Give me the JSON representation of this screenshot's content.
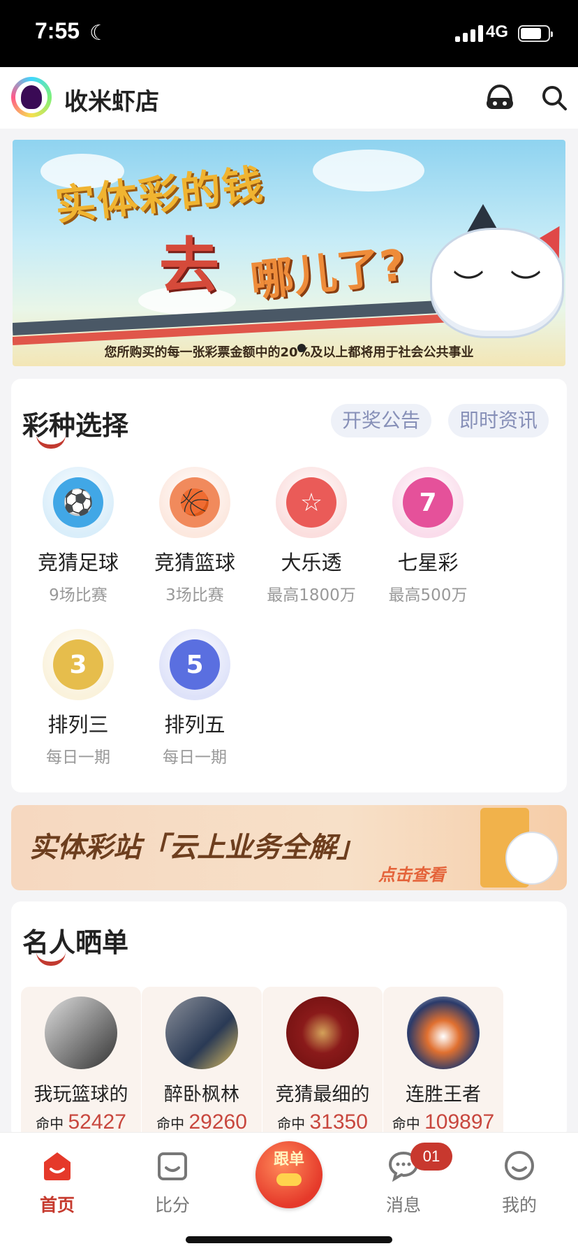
{
  "status_bar": {
    "time": "7:55",
    "network": "4G",
    "battery_level": 0.75
  },
  "header": {
    "title": "收米虾店",
    "icons": [
      "logo-icon",
      "customer-service-icon",
      "search-icon"
    ]
  },
  "banner": {
    "line1": "实体彩的钱",
    "line2": "去",
    "line3": "哪儿了?",
    "caption": "您所购买的每一张彩票金额中的20%及以上都将用于社会公共事业",
    "page_index": 1
  },
  "lottery": {
    "title": "彩种选择",
    "links": [
      "开奖公告",
      "即时资讯"
    ],
    "items": [
      {
        "name": "竞猜足球",
        "sub": "9场比赛",
        "icon": "soccer-ball-icon",
        "glyph": "⚽",
        "color": "#41a7e6"
      },
      {
        "name": "竞猜篮球",
        "sub": "3场比赛",
        "icon": "basketball-icon",
        "glyph": "🏀",
        "color": "#f18a5c"
      },
      {
        "name": "大乐透",
        "sub": "最高1800万",
        "icon": "star-ball-icon",
        "glyph": "☆",
        "color": "#ea5b58"
      },
      {
        "name": "七星彩",
        "sub": "最高500万",
        "icon": "seven-star-icon",
        "glyph": "7",
        "color": "#e5519a"
      },
      {
        "name": "排列三",
        "sub": "每日一期",
        "icon": "number-three-icon",
        "glyph": "3",
        "color": "#e6bd4c"
      },
      {
        "name": "排列五",
        "sub": "每日一期",
        "icon": "number-five-icon",
        "glyph": "5",
        "color": "#5a6fe0"
      }
    ]
  },
  "promo": {
    "title": "实体彩站「云上业务全解」",
    "cta": "点击查看"
  },
  "celebrities": {
    "title": "名人晒单",
    "hit_label": "命中",
    "items": [
      {
        "name": "我玩篮球的",
        "hits": "52427"
      },
      {
        "name": "醉卧枫林",
        "hits": "29260"
      },
      {
        "name": "竞猜最细的",
        "hits": "31350"
      },
      {
        "name": "连胜王者",
        "hits": "109897"
      }
    ]
  },
  "tabbar": {
    "tabs": [
      {
        "label": "首页",
        "icon": "home-icon",
        "active": true
      },
      {
        "label": "比分",
        "icon": "score-icon",
        "active": false
      },
      {
        "label": "跟单",
        "icon": "follow-order-icon",
        "active": false
      },
      {
        "label": "消息",
        "icon": "message-icon",
        "active": false
      },
      {
        "label": "我的",
        "icon": "profile-icon",
        "active": false
      }
    ],
    "message_badge": "01"
  },
  "colors": {
    "accent": "#c63a2e",
    "pill_bg": "#eef1f8",
    "pill_text": "#8790b8"
  }
}
